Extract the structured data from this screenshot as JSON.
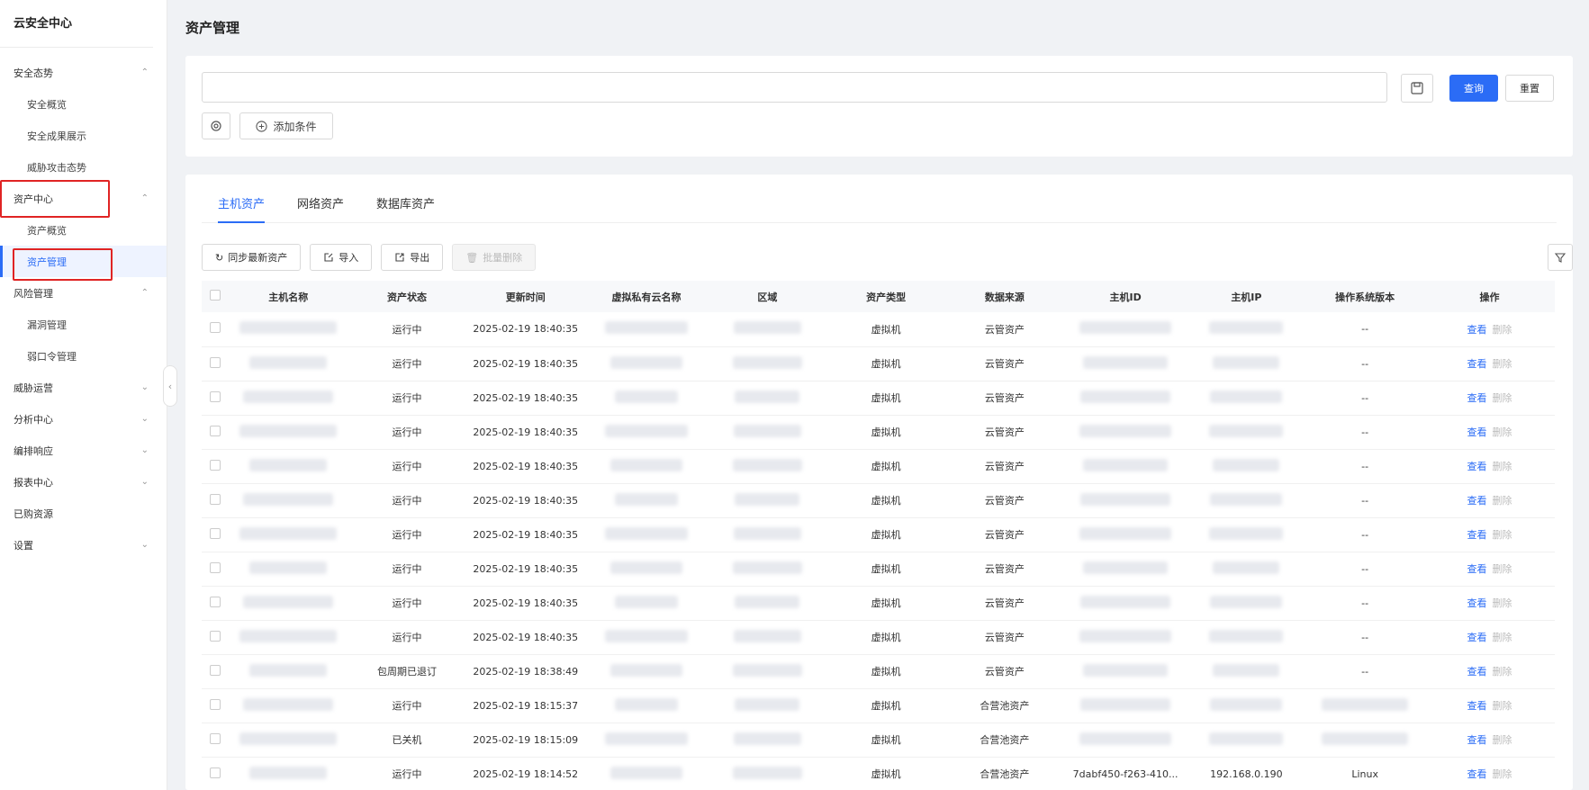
{
  "sidebar": {
    "brand": "云安全中心",
    "items": [
      {
        "label": "安全态势",
        "type": "group",
        "chevron": "up"
      },
      {
        "label": "安全概览",
        "type": "child"
      },
      {
        "label": "安全成果展示",
        "type": "child"
      },
      {
        "label": "威胁攻击态势",
        "type": "child"
      },
      {
        "label": "资产中心",
        "type": "group",
        "chevron": "up"
      },
      {
        "label": "资产概览",
        "type": "child"
      },
      {
        "label": "资产管理",
        "type": "child",
        "active": true
      },
      {
        "label": "风险管理",
        "type": "group",
        "chevron": "up"
      },
      {
        "label": "漏洞管理",
        "type": "child"
      },
      {
        "label": "弱口令管理",
        "type": "child"
      },
      {
        "label": "威胁运营",
        "type": "group",
        "chevron": "down"
      },
      {
        "label": "分析中心",
        "type": "group",
        "chevron": "down"
      },
      {
        "label": "编排响应",
        "type": "group",
        "chevron": "down"
      },
      {
        "label": "报表中心",
        "type": "group",
        "chevron": "down"
      },
      {
        "label": "已购资源",
        "type": "group",
        "chevron": ""
      },
      {
        "label": "设置",
        "type": "group",
        "chevron": "down"
      }
    ]
  },
  "page": {
    "title": "资产管理"
  },
  "query": {
    "input_value": "",
    "search_label": "查询",
    "reset_label": "重置",
    "add_condition_label": "添加条件"
  },
  "tabs": [
    {
      "label": "主机资产",
      "active": true
    },
    {
      "label": "网络资产",
      "active": false
    },
    {
      "label": "数据库资产",
      "active": false
    }
  ],
  "toolbar": {
    "sync_label": "同步最新资产",
    "import_label": "导入",
    "export_label": "导出",
    "batch_delete_label": "批量删除"
  },
  "table": {
    "columns": [
      "主机名称",
      "资产状态",
      "更新时间",
      "虚拟私有云名称",
      "区域",
      "资产类型",
      "数据来源",
      "主机ID",
      "主机IP",
      "操作系统版本",
      "操作"
    ],
    "view_label": "查看",
    "delete_label": "删除",
    "rows": [
      {
        "status": "运行中",
        "time": "2025-02-19 18:40:35",
        "type": "虚拟机",
        "source": "云管资产",
        "host_id": "",
        "host_ip": "",
        "os": "--"
      },
      {
        "status": "运行中",
        "time": "2025-02-19 18:40:35",
        "type": "虚拟机",
        "source": "云管资产",
        "host_id": "",
        "host_ip": "",
        "os": "--"
      },
      {
        "status": "运行中",
        "time": "2025-02-19 18:40:35",
        "type": "虚拟机",
        "source": "云管资产",
        "host_id": "",
        "host_ip": "",
        "os": "--"
      },
      {
        "status": "运行中",
        "time": "2025-02-19 18:40:35",
        "type": "虚拟机",
        "source": "云管资产",
        "host_id": "",
        "host_ip": "",
        "os": "--"
      },
      {
        "status": "运行中",
        "time": "2025-02-19 18:40:35",
        "type": "虚拟机",
        "source": "云管资产",
        "host_id": "",
        "host_ip": "",
        "os": "--"
      },
      {
        "status": "运行中",
        "time": "2025-02-19 18:40:35",
        "type": "虚拟机",
        "source": "云管资产",
        "host_id": "",
        "host_ip": "",
        "os": "--"
      },
      {
        "status": "运行中",
        "time": "2025-02-19 18:40:35",
        "type": "虚拟机",
        "source": "云管资产",
        "host_id": "",
        "host_ip": "",
        "os": "--"
      },
      {
        "status": "运行中",
        "time": "2025-02-19 18:40:35",
        "type": "虚拟机",
        "source": "云管资产",
        "host_id": "",
        "host_ip": "",
        "os": "--"
      },
      {
        "status": "运行中",
        "time": "2025-02-19 18:40:35",
        "type": "虚拟机",
        "source": "云管资产",
        "host_id": "",
        "host_ip": "",
        "os": "--"
      },
      {
        "status": "运行中",
        "time": "2025-02-19 18:40:35",
        "type": "虚拟机",
        "source": "云管资产",
        "host_id": "",
        "host_ip": "",
        "os": "--"
      },
      {
        "status": "包周期已退订",
        "time": "2025-02-19 18:38:49",
        "type": "虚拟机",
        "source": "云管资产",
        "host_id": "",
        "host_ip": "",
        "os": "--"
      },
      {
        "status": "运行中",
        "time": "2025-02-19 18:15:37",
        "type": "虚拟机",
        "source": "合营池资产",
        "host_id": "",
        "host_ip": "",
        "os": ""
      },
      {
        "status": "已关机",
        "time": "2025-02-19 18:15:09",
        "type": "虚拟机",
        "source": "合营池资产",
        "host_id": "",
        "host_ip": "",
        "os": ""
      },
      {
        "status": "运行中",
        "time": "2025-02-19 18:14:52",
        "type": "虚拟机",
        "source": "合营池资产",
        "host_id": "7dabf450-f263-410...",
        "host_ip": "192.168.0.190",
        "os": "Linux"
      }
    ]
  },
  "colors": {
    "primary": "#2b6cf6",
    "highlight": "#e02424"
  }
}
